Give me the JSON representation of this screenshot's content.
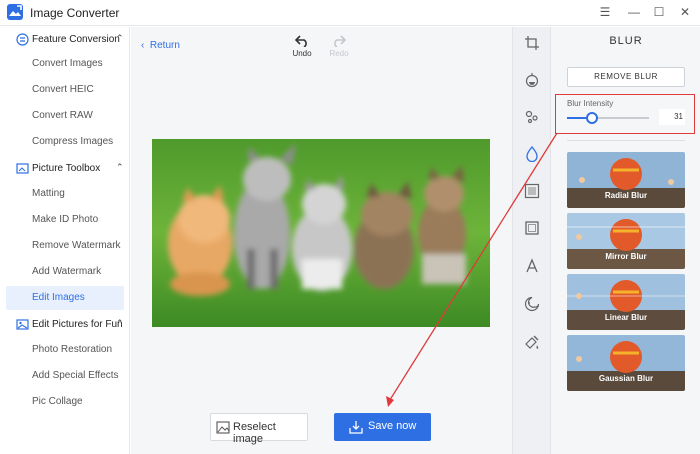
{
  "app": {
    "title": "Image Converter",
    "icon": "image-converter-logo"
  },
  "window_controls": {
    "menu_icon": "menu-icon",
    "minimize_icon": "minimize-icon",
    "maximize_icon": "maximize-icon",
    "close_icon": "close-icon"
  },
  "sidebar": {
    "sections": [
      {
        "label": "Feature Conversion",
        "icon": "feature-conversion-icon",
        "items": [
          "Convert Images",
          "Convert HEIC",
          "Convert RAW",
          "Compress Images"
        ]
      },
      {
        "label": "Picture Toolbox",
        "icon": "picture-toolbox-icon",
        "items": [
          "Matting",
          "Make ID Photo",
          "Remove Watermark",
          "Add Watermark",
          "Edit Images"
        ]
      },
      {
        "label": "Edit Pictures for Fun",
        "icon": "edit-fun-icon",
        "items": [
          "Photo Restoration",
          "Add Special Effects",
          "Pic Collage"
        ]
      }
    ],
    "active_item": "Edit Images"
  },
  "editor": {
    "return_label": "Return",
    "undo_label": "Undo",
    "redo_label": "Redo",
    "photo_description_icon": "kittens-photo",
    "reselect_label": "Reselect image",
    "save_label": "Save now"
  },
  "tool_rail": {
    "icons": [
      "crop-icon",
      "adjust-icon",
      "effects-icon",
      "blur-icon",
      "filter-icon",
      "frame-icon",
      "text-icon",
      "sticker-icon",
      "paint-icon"
    ],
    "active": "blur-icon"
  },
  "panel": {
    "title": "BLUR",
    "remove_label": "REMOVE BLUR",
    "intensity_label": "Blur Intensity",
    "intensity_value": "31",
    "intensity_fraction": 0.31,
    "effects": [
      "Radial Blur",
      "Mirror Blur",
      "Linear Blur",
      "Gaussian Blur"
    ]
  },
  "colors": {
    "accent": "#2f6fe4",
    "annotation": "#e03a3a"
  }
}
